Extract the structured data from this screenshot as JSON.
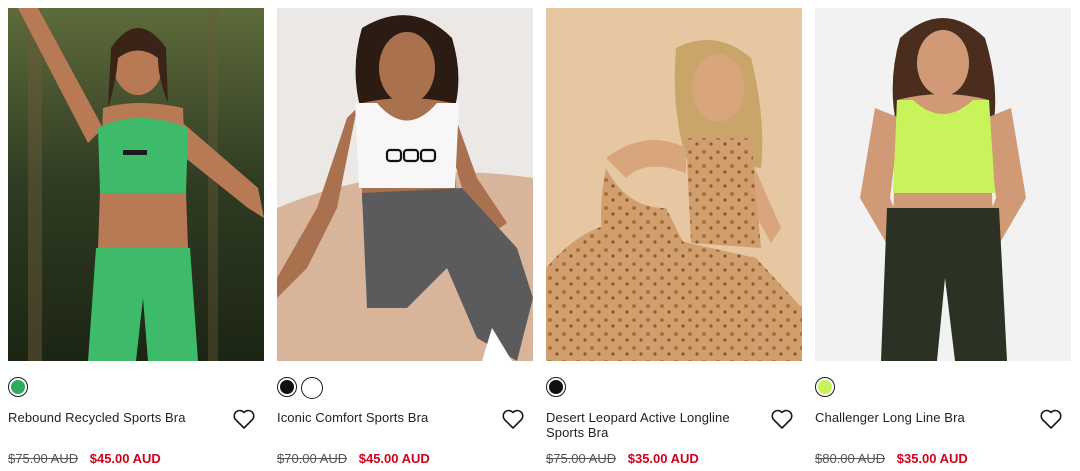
{
  "products": [
    {
      "name": "Rebound Recycled Sports Bra",
      "old_price": "$75.00 AUD",
      "sale_price": "$45.00 AUD",
      "swatches": [
        "#2fa860"
      ],
      "image_alt": "product-photo-green-sports-bra",
      "colors": {
        "bg": "#3b4a2a",
        "top": "#3dbb6a",
        "bottom": "#3dbb6a",
        "skin": "#b87a55",
        "hair": "#3a2418"
      }
    },
    {
      "name": "Iconic Comfort Sports Bra",
      "old_price": "$70.00 AUD",
      "sale_price": "$45.00 AUD",
      "swatches": [
        "#111111",
        "#ffffff"
      ],
      "image_alt": "product-photo-white-sports-bra",
      "colors": {
        "bg": "#e9e4e0",
        "top": "#f7f7f7",
        "bottom": "#5b5b5d",
        "skin": "#a9714e",
        "hair": "#2b1b12"
      }
    },
    {
      "name": "Desert Leopard Active Longline Sports Bra",
      "old_price": "$75.00 AUD",
      "sale_price": "$35.00 AUD",
      "swatches": [
        "#111111"
      ],
      "image_alt": "product-photo-leopard-longline-bra",
      "colors": {
        "bg": "#e7c7a1",
        "top": "#c99062",
        "bottom": "#d19e6d",
        "skin": "#d9a57c",
        "hair": "#c9a56a"
      }
    },
    {
      "name": "Challenger Long Line Bra",
      "old_price": "$80.00 AUD",
      "sale_price": "$35.00 AUD",
      "swatches": [
        "#c6f25a"
      ],
      "image_alt": "product-photo-lime-long-line-bra",
      "colors": {
        "bg": "#f2f2f2",
        "top": "#c8f35b",
        "bottom": "#2b3224",
        "skin": "#d09a76",
        "hair": "#4a2d1c"
      }
    }
  ]
}
